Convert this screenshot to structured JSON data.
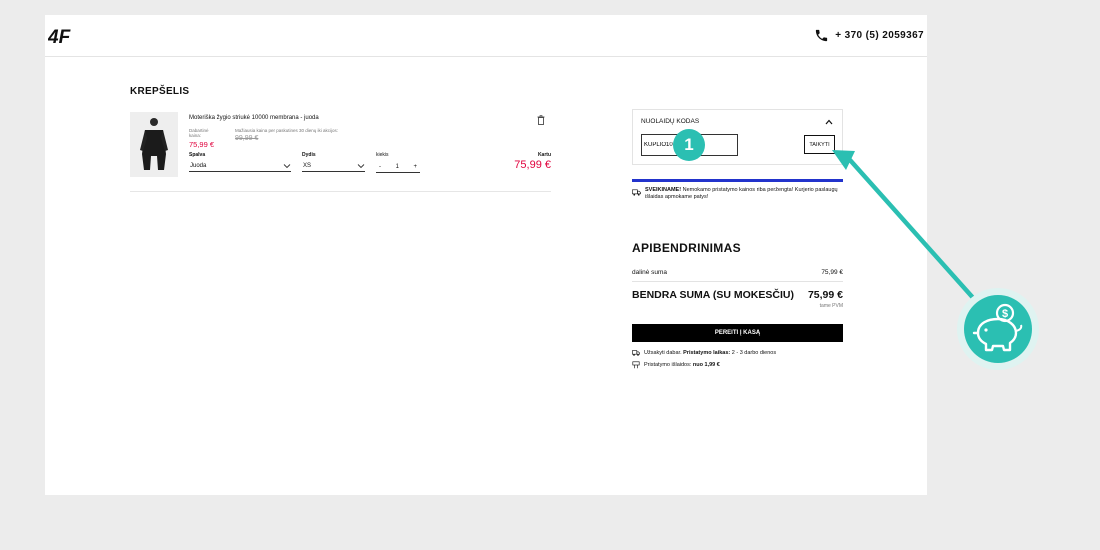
{
  "header": {
    "logo_text": "4F",
    "phone": "+ 370 (5) 2059367",
    "phone_icon": "phone-icon"
  },
  "cart": {
    "title": "KREPŠELIS",
    "item": {
      "name": "Moteriška žygio striukė 10000 membrana - juoda",
      "current_price_label": "Dabartinė kaina:",
      "current_price": "75,99 €",
      "lowest_price_label": "Mažiausia kaina per paskutines 30 dienų iki akcijos:",
      "old_price": "99,99 €",
      "color_label": "Spalva",
      "color_value": "Juoda",
      "size_label": "Dydis",
      "size_value": "XS",
      "qty_label": "kiekis",
      "qty_minus": "-",
      "qty_value": "1",
      "qty_plus": "+",
      "total_label": "Kartu",
      "total_price": "75,99 €"
    }
  },
  "discount": {
    "title": "NUOLAIDŲ KODAS",
    "code_value": "KUPLIO10",
    "apply_label": "TAIKYTI",
    "badge": "1"
  },
  "shipping": {
    "message_bold": "SVEIKINAME!",
    "message": "Nemokamo pristatymo kainos riba peržengta! Kurjerio paslaugų išlaidas apmokame patys!"
  },
  "summary": {
    "title": "APIBENDRINIMAS",
    "subtotal_label": "dalinė suma",
    "subtotal_value": "75,99 €",
    "total_label": "BENDRA SUMA (SU MOKESČIU)",
    "total_value": "75,99 €",
    "vat_note": "tame PVM",
    "checkout_label": "PEREITI Į KASĄ",
    "delivery_prefix": "Užsakyti dabar.",
    "delivery_bold": "Pristatymo laikas:",
    "delivery_time": "2 - 3 darbo dienos",
    "cost_prefix": "Pristatymo išlaidos:",
    "cost_bold": "nuo 1,99 €"
  },
  "colors": {
    "accent_red": "#e0003c",
    "teal": "#2bbfb2",
    "bar_blue": "#2233cc"
  }
}
